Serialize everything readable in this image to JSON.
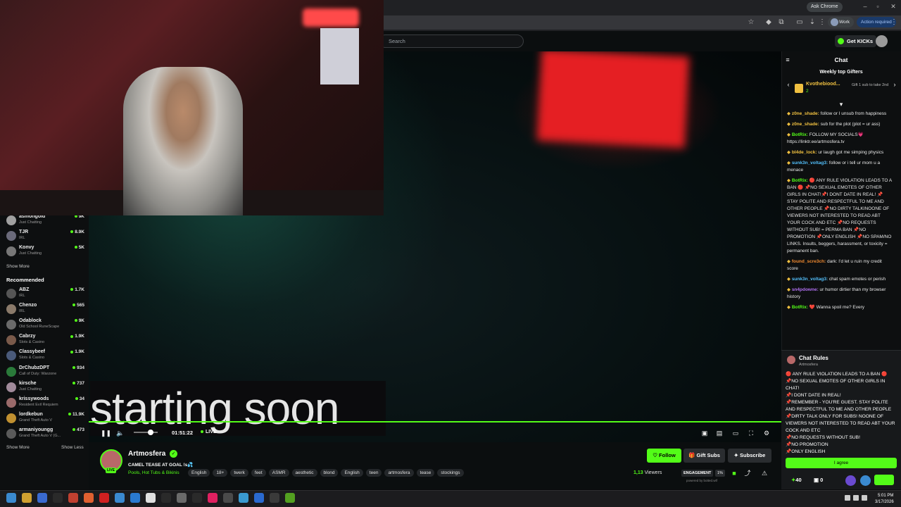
{
  "browser": {
    "ask_chrome": "Ask Chrome",
    "profile_label": "Work",
    "action_required": "Action required"
  },
  "kick": {
    "search_placeholder": "Search",
    "get_kicks": "Get KICKs"
  },
  "sidebar": {
    "following": [
      {
        "name": "asmongold",
        "category": "Just Chatting",
        "viewers": "9K",
        "color": "#a0a0a0"
      },
      {
        "name": "TJR",
        "category": "IRL",
        "viewers": "8.9K",
        "color": "#6a6a7a"
      },
      {
        "name": "Konvy",
        "category": "Just Chatting",
        "viewers": "5K",
        "color": "#777"
      }
    ],
    "show_more_top": "Show More",
    "recommended_title": "Recommended",
    "recommended": [
      {
        "name": "ABZ",
        "category": "IRL",
        "viewers": "1.7K",
        "color": "#555"
      },
      {
        "name": "Chenzo",
        "category": "IRL",
        "viewers": "565",
        "color": "#8a7a6a"
      },
      {
        "name": "Odablock",
        "category": "Old School RuneScape",
        "viewers": "9K",
        "color": "#6a6a6a"
      },
      {
        "name": "Cabrzy",
        "category": "Slots & Casino",
        "viewers": "1.9K",
        "color": "#7a5a4a"
      },
      {
        "name": "Classybeef",
        "category": "Slots & Casino",
        "viewers": "1.9K",
        "color": "#4a5a7a"
      },
      {
        "name": "DrChubzDPT",
        "category": "Call of Duty: Warzone",
        "viewers": "934",
        "color": "#2a7a3a"
      },
      {
        "name": "kirsche",
        "category": "Just Chatting",
        "viewers": "737",
        "color": "#a08a9a"
      },
      {
        "name": "krissywoods",
        "category": "Resident Evil Requiem",
        "viewers": "34",
        "color": "#9a6a6a"
      },
      {
        "name": "lordkebun",
        "category": "Grand Theft Auto V",
        "viewers": "11.9K",
        "color": "#c09030"
      },
      {
        "name": "armaniyoungg",
        "category": "Grand Theft Auto V (G...",
        "viewers": "473",
        "color": "#5a5a5a"
      }
    ],
    "show_more": "Show More",
    "show_less": "Show Less"
  },
  "player": {
    "overlay_text": "starting soon",
    "time": "01:51:22",
    "live": "LIVE",
    "progress": 1.0
  },
  "stream": {
    "streamer": "Artmosfera",
    "title": "CAMEL TEASE AT GOAL !s💦",
    "category": "Pools, Hot Tubs & Bikinis",
    "live_badge": "LIVE",
    "tags": [
      "English",
      "18+",
      "twerk",
      "feet",
      "ASMR",
      "aesthetic",
      "blond",
      "English",
      "teen",
      "artmosfera",
      "tease",
      "stockings"
    ],
    "follow": "Follow",
    "gift_subs": "Gift Subs",
    "subscribe": "Subscribe",
    "viewers_num": "1,13",
    "viewers_label": "Viewers",
    "engagement_label": "ENGAGEMENT",
    "engagement_pct": "1%",
    "powered_by": "powered by botted.wtf"
  },
  "chat": {
    "title": "Chat",
    "gifters_title": "Weekly top Gifters",
    "gifter_name": "Kvothebiood...",
    "gifter_count": "2",
    "gift_hint": "Gift 1 sub to take 2nd",
    "messages": [
      {
        "user": "z0ne_shade:",
        "text": " follow or I unsub from happiness",
        "color": "#f0c040"
      },
      {
        "user": "z0ne_shade:",
        "text": " sub for the plot (plot = ur ass)",
        "color": "#f0c040"
      },
      {
        "user": "BotRix:",
        "text": " FOLLOW MY SOCIALS💗 https://linktr.ee/artmosfera.tv",
        "color": "#53fc18"
      },
      {
        "user": "bl4de_lock:",
        "text": " ur laugh got me simping physics",
        "color": "#f0c040"
      },
      {
        "user": "sunk3n_voltag3:",
        "text": " follow or i tell ur mom u a menace",
        "color": "#53c0fc"
      },
      {
        "user": "BotRix:",
        "text": " 🔴 ANY RULE VIOLATION LEADS TO A BAN 🔴 📌NO SEXUAL EMOTES OF OTHER GIRLS IN CHAT!📌I DONT DATE IN REAL! 📌STAY POLITE AND RESPECTFUL TO ME AND OTHER PEOPLE 📌NO DIRTY TALKINOONE OF VIEWERS NOT INTERESTED TO READ ABT YOUR COCK AND ETC 📌NO REQUESTS WITHOUT SUB! = PERMA BAN 📌NO PROMOTION 📌ONLY ENGLISH 📌NO SPAM/NO LINKS. Insults, beggers, harassment, or toxicity = permanent ban.",
        "color": "#53fc18"
      },
      {
        "user": "found_scre3ch:",
        "text": " dark: I'd let u ruin my credit score",
        "color": "#f08a30"
      },
      {
        "user": "sunk3n_voltag3:",
        "text": " chat spam emotes or perish",
        "color": "#53c0fc"
      },
      {
        "user": "sn4pdowne:",
        "text": " ur humor dirtier than my browser history",
        "color": "#b070f0"
      },
      {
        "user": "BotRix:",
        "text": " ❤️ Wanna spoil me? Every",
        "color": "#53fc18"
      }
    ],
    "rules_title": "Chat Rules",
    "rules_sub": "Artmosfera",
    "rules": [
      "🔴 ANY RULE VIOLATION LEADS TO A BAN 🔴",
      "📌NO SEXUAL EMOTES OF OTHER GIRLS IN CHAT!",
      "📌I DONT DATE IN REAL!",
      "📌REMEMBER - YOU'RE GUEST. STAY POLITE AND RESPECTFUL TO ME AND OTHER PEOPLE",
      "📌DIRTY TALK ONLY FOR SUBS! NOONE OF VIEWERS NOT INTERESTED TO READ ABT YOUR COCK AND ETC",
      "📌NO REQUESTS WITHOUT SUB!",
      "📌NO PROMOTION",
      "📌ONLY ENGLISH"
    ],
    "agree": "I agree",
    "points": "40",
    "gifts": "0"
  },
  "taskbar": {
    "time": "5:01 PM",
    "date": "3/17/2026"
  }
}
